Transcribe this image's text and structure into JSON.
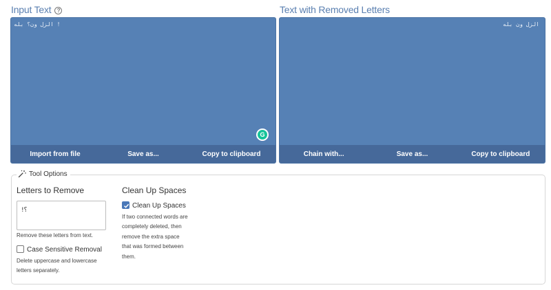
{
  "input_panel": {
    "title": "Input Text",
    "info_glyph": "?",
    "content": "! الزل ون؟ بله",
    "buttons": [
      "Import from file",
      "Save as...",
      "Copy to clipboard"
    ]
  },
  "output_panel": {
    "title": "Text with Removed Letters",
    "content": "الزل ون بله",
    "buttons": [
      "Chain with...",
      "Save as...",
      "Copy to clipboard"
    ]
  },
  "grammarly_glyph": "G",
  "tool_options": {
    "legend": "Tool Options",
    "letters": {
      "title": "Letters to Remove",
      "value": "!؟",
      "help": "Remove these letters from text.",
      "case_label": "Case Sensitive Removal",
      "case_checked": false,
      "case_help_1": "Delete uppercase and lowercase",
      "case_help_2": "letters separately."
    },
    "spaces": {
      "title": "Clean Up Spaces",
      "checkbox_label": "Clean Up Spaces",
      "checked": true,
      "help_1": "If two connected words are",
      "help_2": "completely deleted, then",
      "help_3": "remove the extra space",
      "help_4": "that was formed between",
      "help_5": "them."
    }
  },
  "colors": {
    "panel": "#5681b5",
    "panel_bar": "#46699a",
    "title": "#5a7fb0",
    "checkbox": "#4a78b8"
  }
}
